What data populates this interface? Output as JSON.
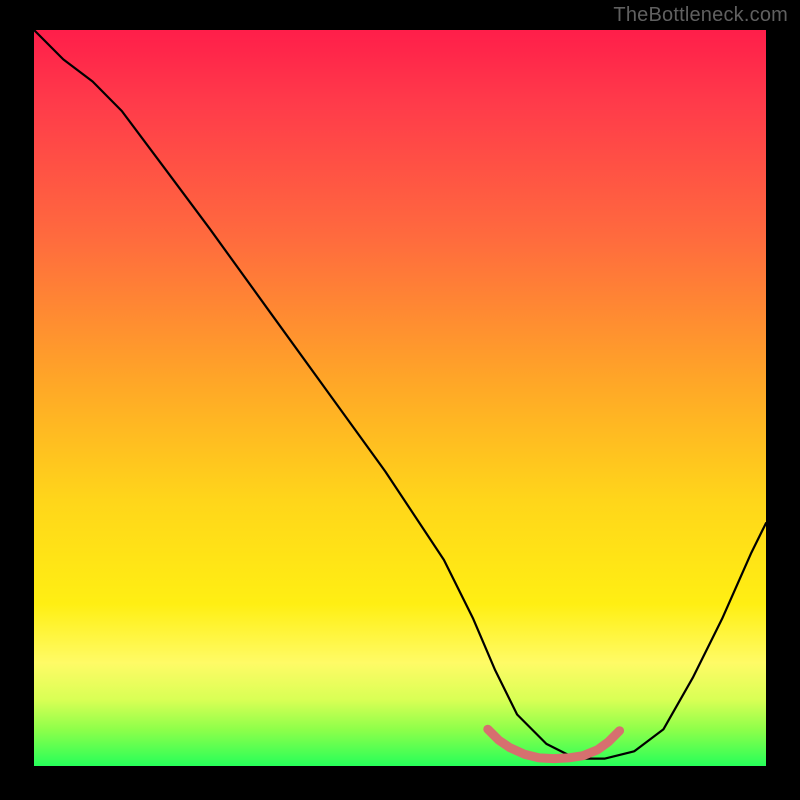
{
  "watermark": "TheBottleneck.com",
  "chart_data": {
    "type": "line",
    "title": "",
    "xlabel": "",
    "ylabel": "",
    "xlim": [
      0,
      100
    ],
    "ylim": [
      0,
      100
    ],
    "series": [
      {
        "name": "bottleneck-curve",
        "x": [
          0,
          4,
          8,
          12,
          18,
          24,
          32,
          40,
          48,
          56,
          60,
          63,
          66,
          70,
          74,
          78,
          82,
          86,
          90,
          94,
          98,
          100
        ],
        "y": [
          100,
          96,
          93,
          89,
          81,
          73,
          62,
          51,
          40,
          28,
          20,
          13,
          7,
          3,
          1,
          1,
          2,
          5,
          12,
          20,
          29,
          33
        ]
      }
    ],
    "highlight_segment": {
      "name": "min-plateau",
      "color": "#d6706f",
      "x": [
        62,
        63.5,
        65,
        67,
        69,
        71,
        73,
        75,
        77,
        78.5,
        80
      ],
      "y": [
        5.0,
        3.5,
        2.5,
        1.6,
        1.1,
        1.0,
        1.1,
        1.4,
        2.2,
        3.3,
        4.8
      ]
    },
    "gradient_stops": [
      {
        "pos": 0.0,
        "color": "#ff1e4a"
      },
      {
        "pos": 0.1,
        "color": "#ff3b4a"
      },
      {
        "pos": 0.28,
        "color": "#ff6a3e"
      },
      {
        "pos": 0.48,
        "color": "#ffa727"
      },
      {
        "pos": 0.64,
        "color": "#ffd61a"
      },
      {
        "pos": 0.78,
        "color": "#ffef13"
      },
      {
        "pos": 0.86,
        "color": "#fffb66"
      },
      {
        "pos": 0.91,
        "color": "#d9ff55"
      },
      {
        "pos": 0.95,
        "color": "#8fff4a"
      },
      {
        "pos": 1.0,
        "color": "#26ff59"
      }
    ]
  }
}
